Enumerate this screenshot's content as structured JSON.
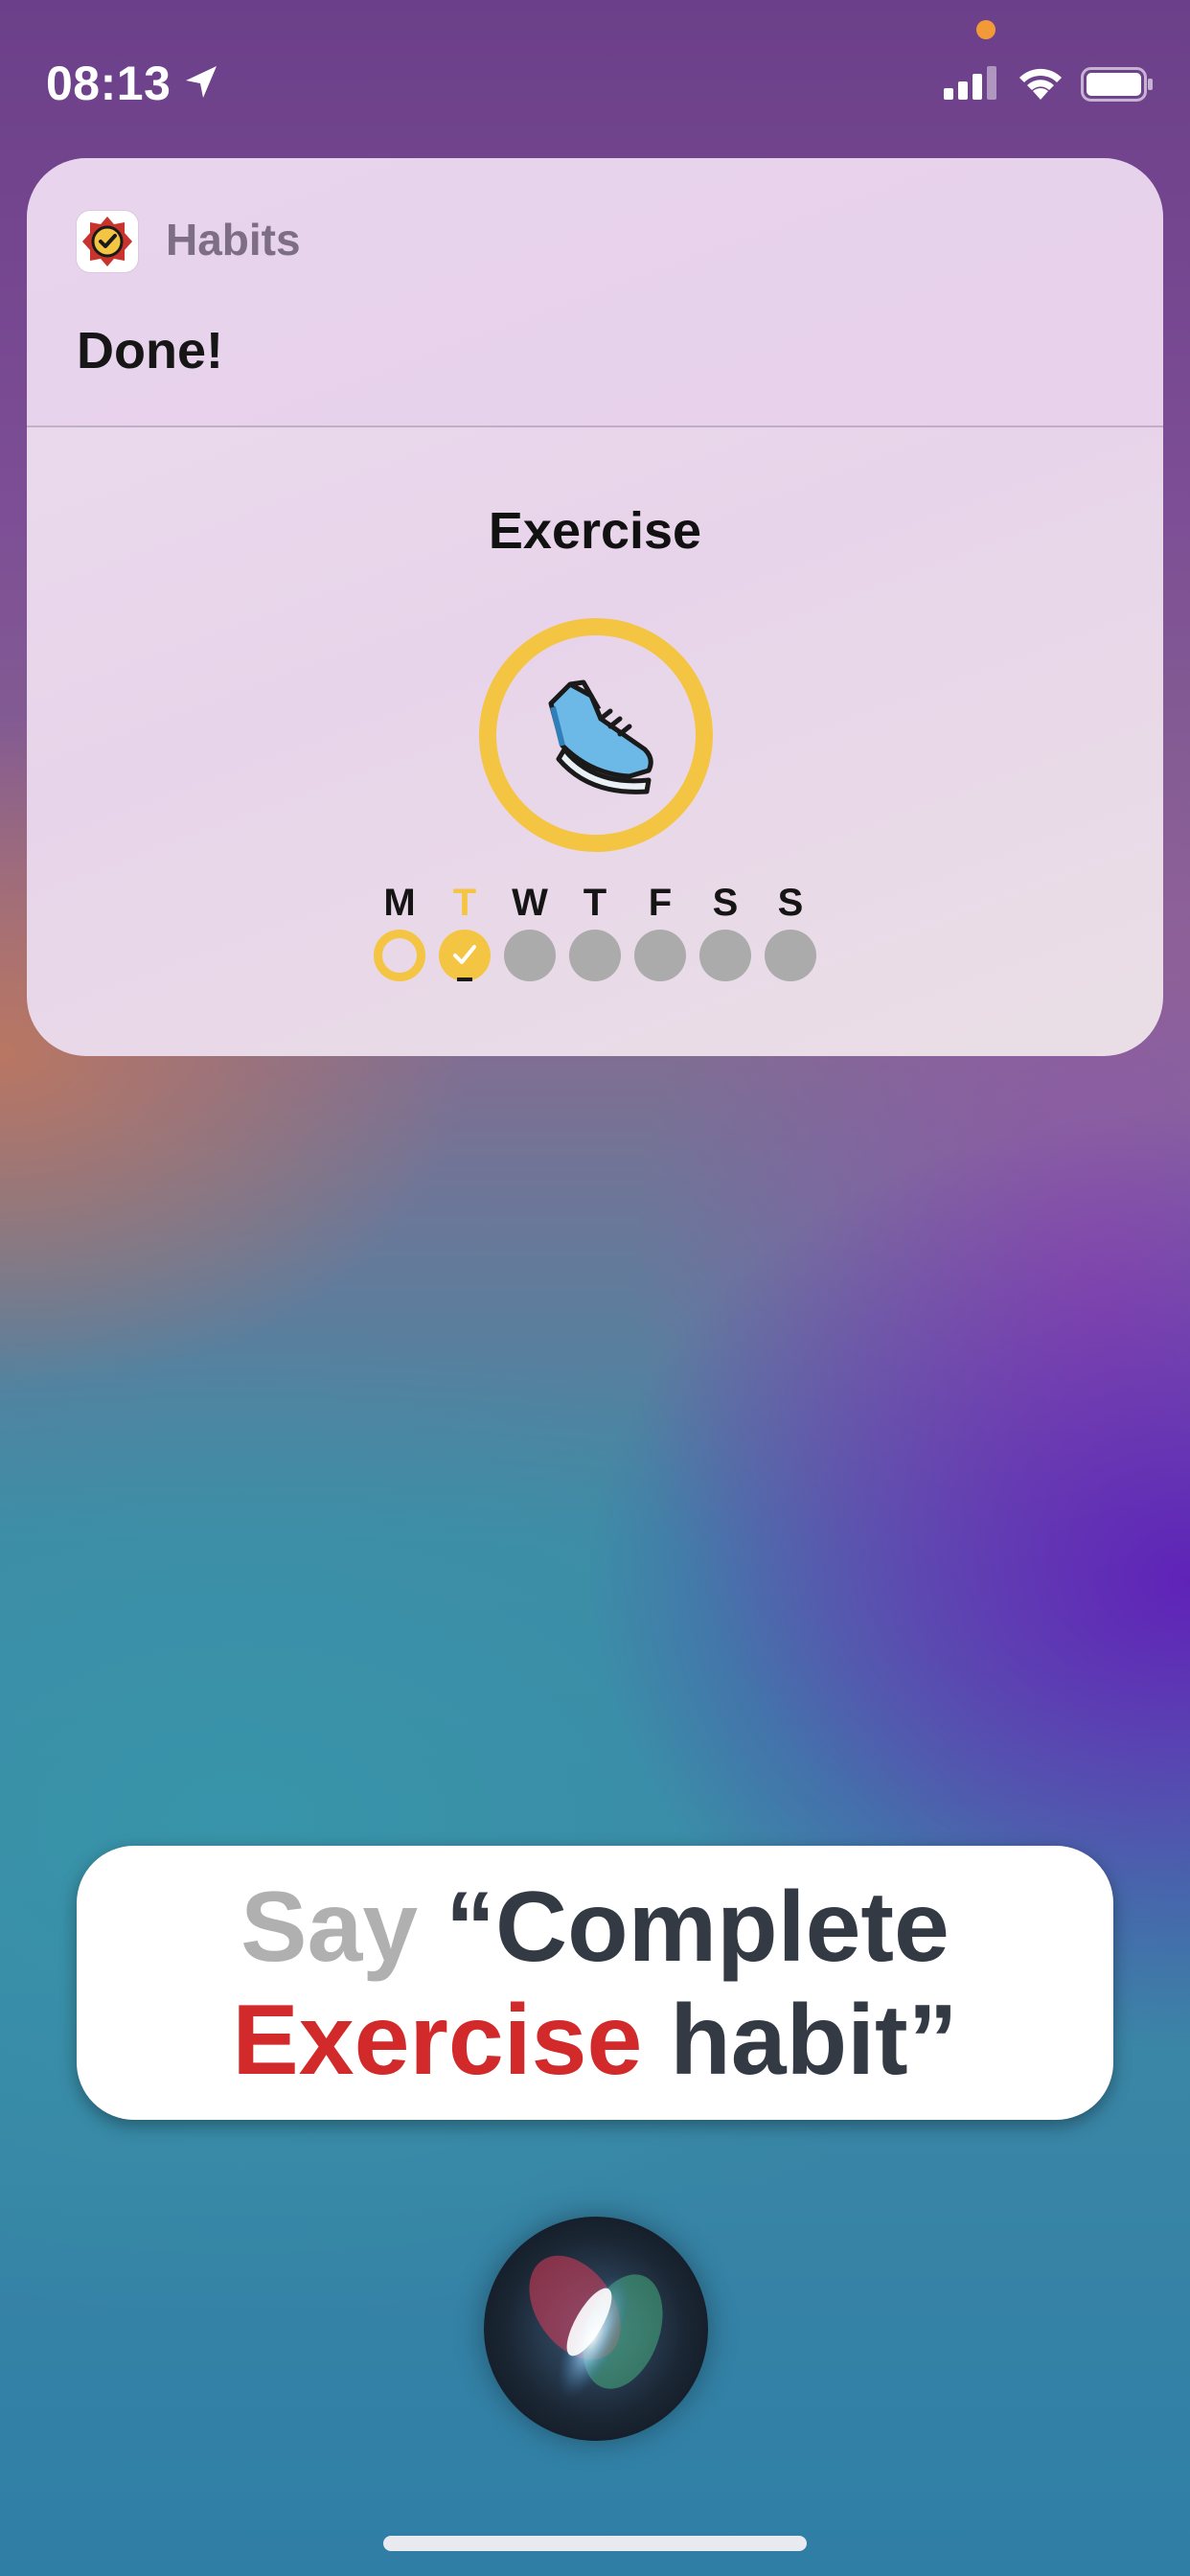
{
  "status_bar": {
    "time": "08:13",
    "location_icon": "location-arrow-icon",
    "signal_icon": "cellular-signal-icon",
    "wifi_icon": "wifi-icon",
    "battery_icon": "battery-icon",
    "privacy_dot_color": "#f29a38"
  },
  "notification": {
    "app_name": "Habits",
    "app_icon": "habits-badge-icon",
    "message": "Done!",
    "habit": {
      "title": "Exercise",
      "icon": "running-shoe-icon",
      "ring_color": "#f4c542",
      "days": [
        {
          "label": "M",
          "state": "partial"
        },
        {
          "label": "T",
          "state": "done",
          "today": true
        },
        {
          "label": "W",
          "state": "empty"
        },
        {
          "label": "T",
          "state": "empty"
        },
        {
          "label": "F",
          "state": "empty"
        },
        {
          "label": "S",
          "state": "empty"
        },
        {
          "label": "S",
          "state": "empty"
        }
      ]
    }
  },
  "siri_prompt": {
    "say": "Say",
    "quote_open_text": "“Complete",
    "habit_word": "Exercise",
    "quote_close_text": "habit”",
    "accent_color": "#d22a2a"
  },
  "siri": {
    "orb_icon": "siri-orb-icon"
  }
}
